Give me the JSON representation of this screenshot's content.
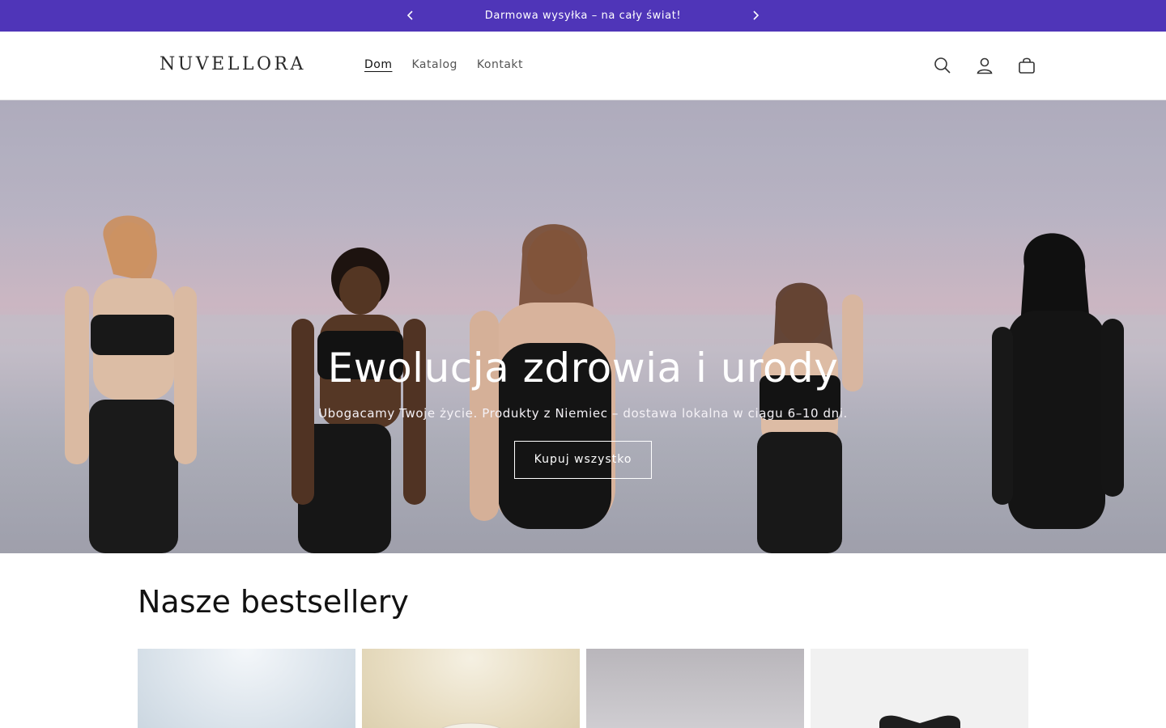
{
  "announcement": {
    "text": "Darmowa wysyłka – na cały świat!",
    "prev_icon": "chevron-left-icon",
    "next_icon": "chevron-right-icon"
  },
  "header": {
    "logo": "NUVELLORA",
    "nav": [
      {
        "label": "Dom",
        "active": true
      },
      {
        "label": "Katalog",
        "active": false
      },
      {
        "label": "Kontakt",
        "active": false
      }
    ],
    "icons": [
      "search-icon",
      "account-icon",
      "cart-icon"
    ]
  },
  "hero": {
    "title": "Ewolucja zdrowia i urody",
    "subtitle": "Ubogacamy Twoje życie. Produkty z Niemiec – dostawa lokalna w ciągu 6–10 dni.",
    "button_label": "Kupuj wszystko"
  },
  "bestsellers": {
    "title": "Nasze bestsellery",
    "products": [
      {
        "image": "product-image-1"
      },
      {
        "image": "product-image-2"
      },
      {
        "image": "product-image-3"
      },
      {
        "image": "product-image-4"
      }
    ]
  },
  "colors": {
    "announcement_bg": "#4f35b8",
    "text": "#121212",
    "nav_text": "#555555"
  }
}
